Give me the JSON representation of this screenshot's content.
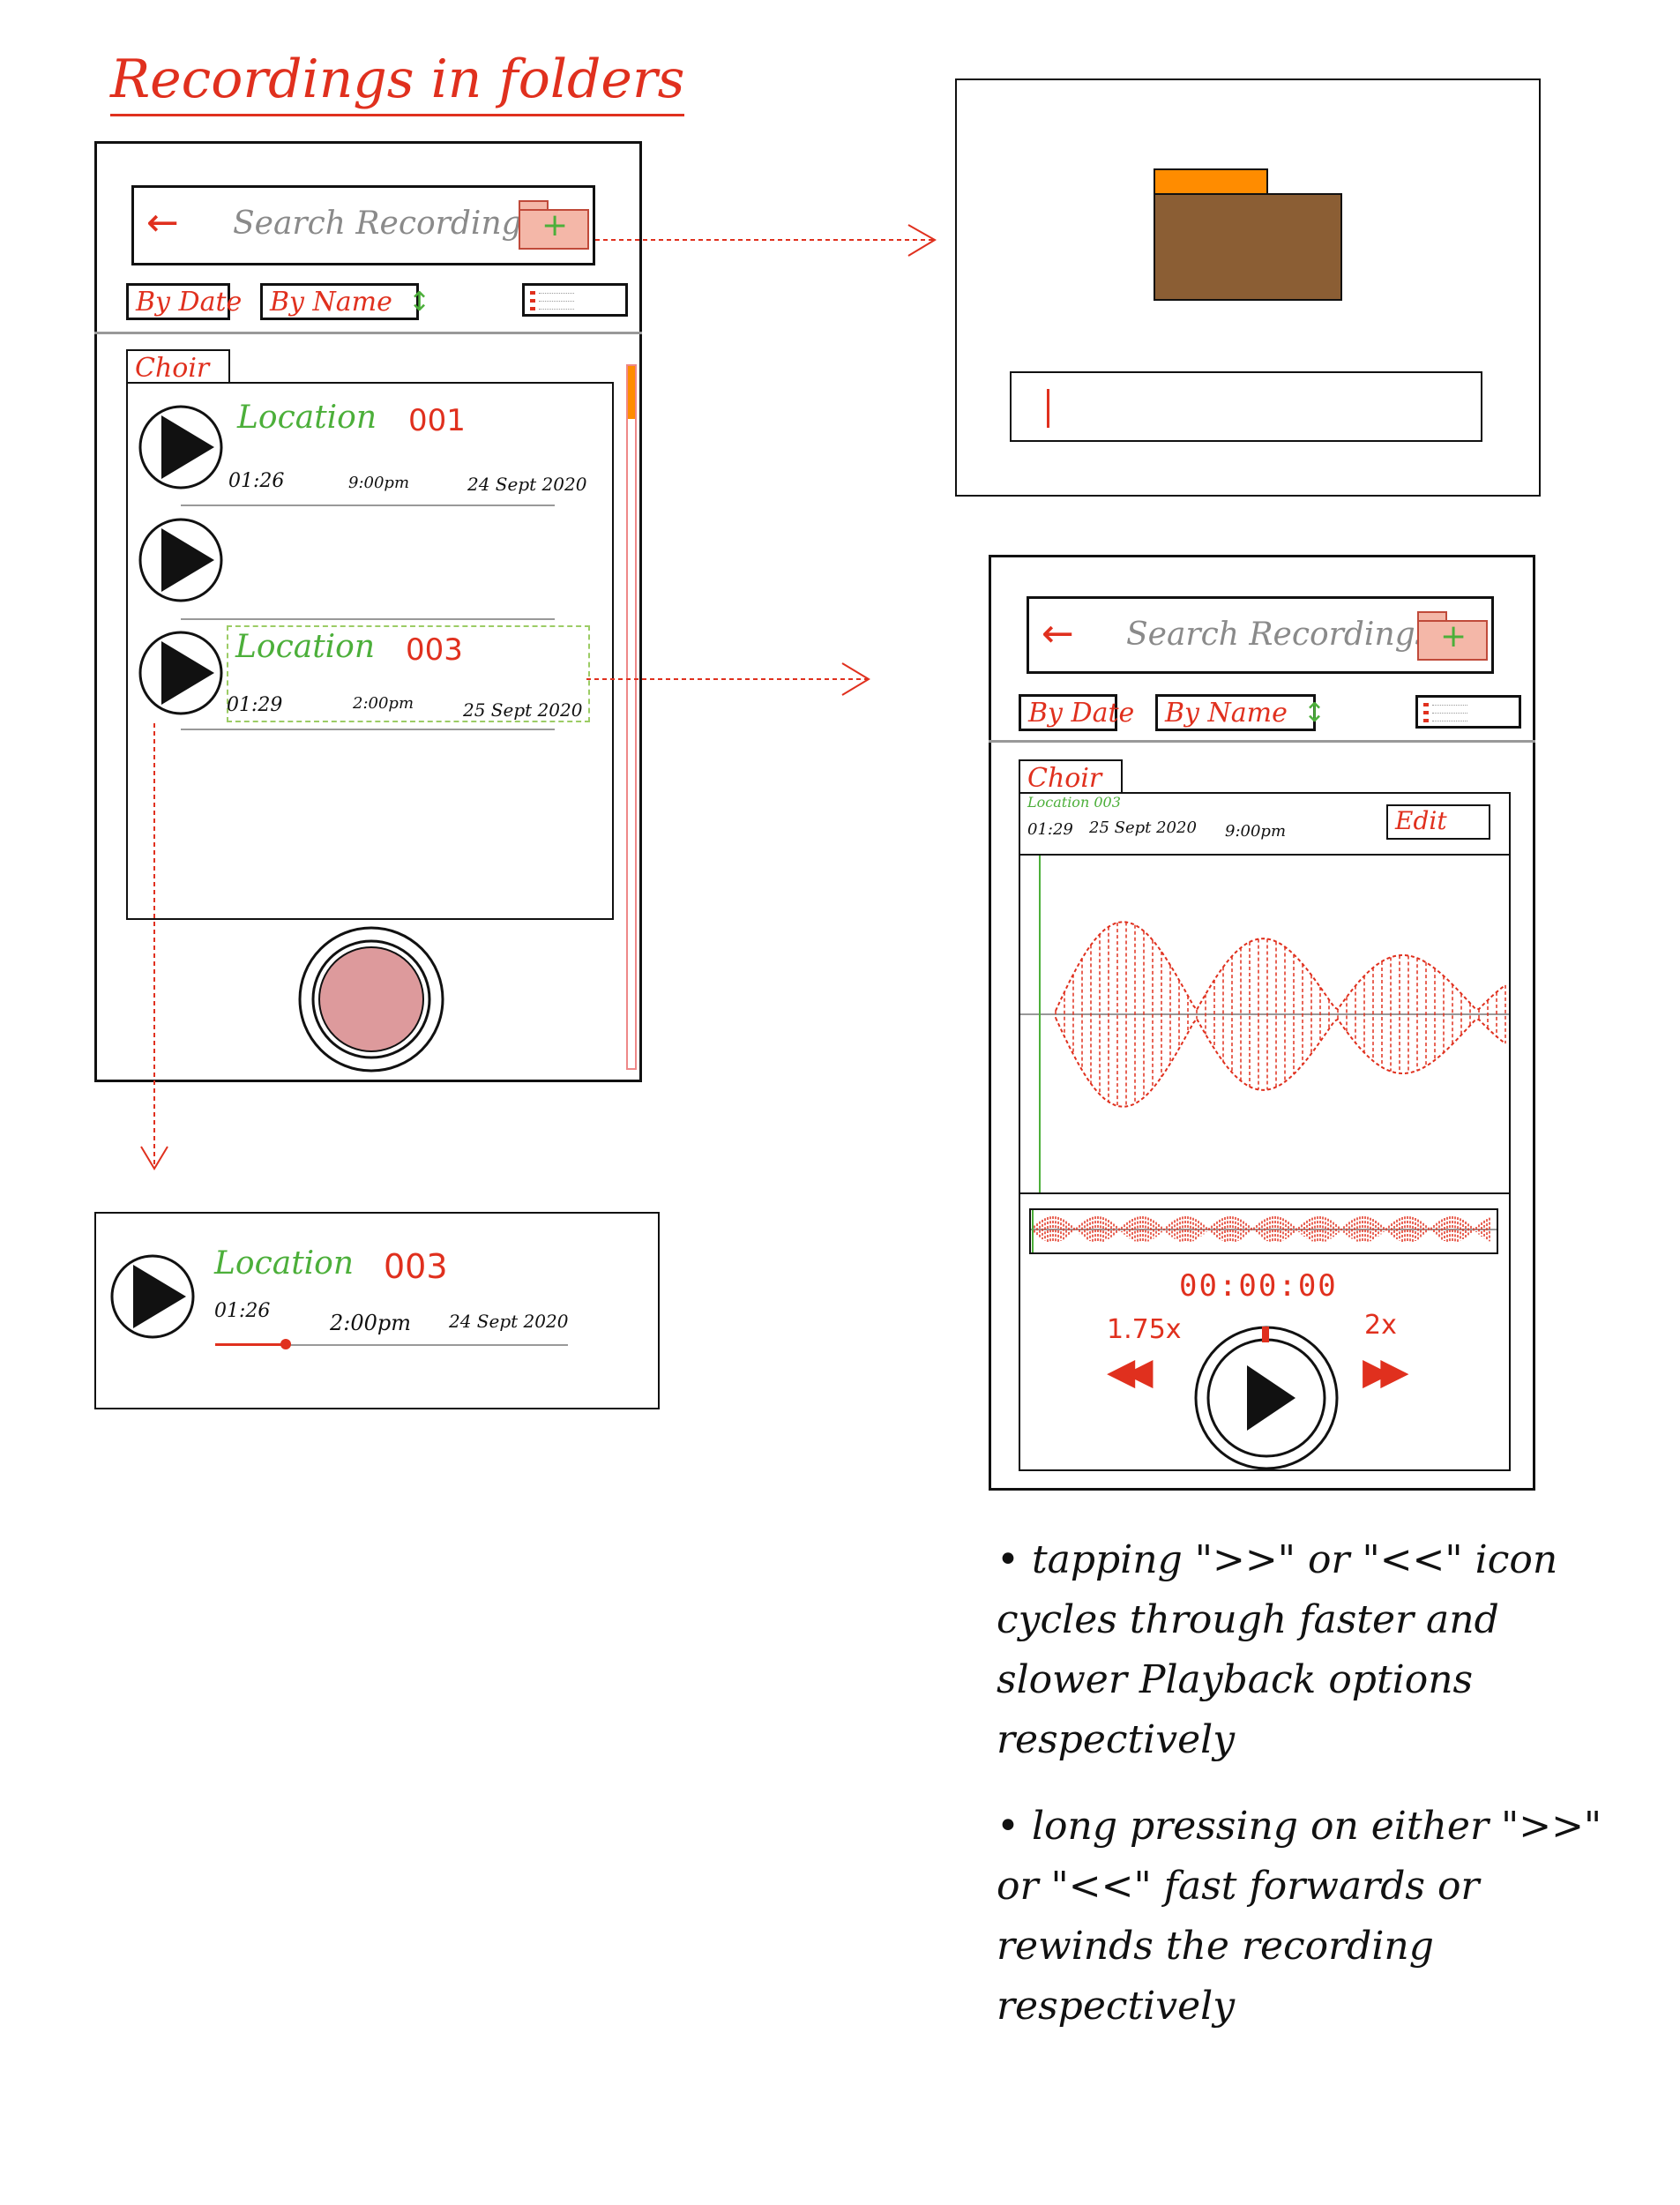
{
  "page_title": "Recordings in folders",
  "search": {
    "back_glyph": "←",
    "placeholder": "Search Recordings",
    "add_glyph": "+"
  },
  "sort": {
    "by_date": "By Date",
    "by_name": "By Name",
    "sort_glyph": "↕"
  },
  "folder": {
    "name": "Choir"
  },
  "recordings": [
    {
      "location": "Location",
      "number": "001",
      "duration": "01:26",
      "time": "9:00pm",
      "date": "24 Sept 2020"
    },
    {
      "location": "",
      "number": "",
      "duration": "",
      "time": "",
      "date": ""
    },
    {
      "location": "Location",
      "number": "003",
      "duration": "01:29",
      "time": "2:00pm",
      "date": "25 Sept 2020"
    }
  ],
  "expanded_item": {
    "location": "Location",
    "number": "003",
    "duration": "01:26",
    "time": "2:00pm",
    "date": "24 Sept 2020",
    "progress": 0.2
  },
  "player": {
    "folder": "Choir",
    "location": "Location 003",
    "duration": "01:29",
    "date": "25 Sept 2020",
    "time": "9:00pm",
    "edit_label": "Edit",
    "timer": "00:00:00",
    "slow_speed": "1.75x",
    "fast_speed": "2x",
    "rewind_glyph": "◀◀",
    "forward_glyph": "▶▶"
  },
  "notes": [
    "• tapping \">>\" or \"<<\" icon cycles through faster and slower Playback options respectively",
    "• long pressing on either \">>\" or \"<<\" fast forwards or rewinds the recording respectively"
  ],
  "colors": {
    "accent_red": "#e0301e",
    "green": "#4caf3a",
    "folder_brown": "#8b5e34",
    "folder_tab_orange": "#ff8c00",
    "record_button": "#dd9a9c",
    "add_folder_fill": "#f4b7a8"
  },
  "icons": [
    "back-arrow-icon",
    "add-folder-icon",
    "sort-icon",
    "list-view-icon",
    "play-icon",
    "record-icon",
    "rewind-icon",
    "fast-forward-icon",
    "folder-icon"
  ]
}
